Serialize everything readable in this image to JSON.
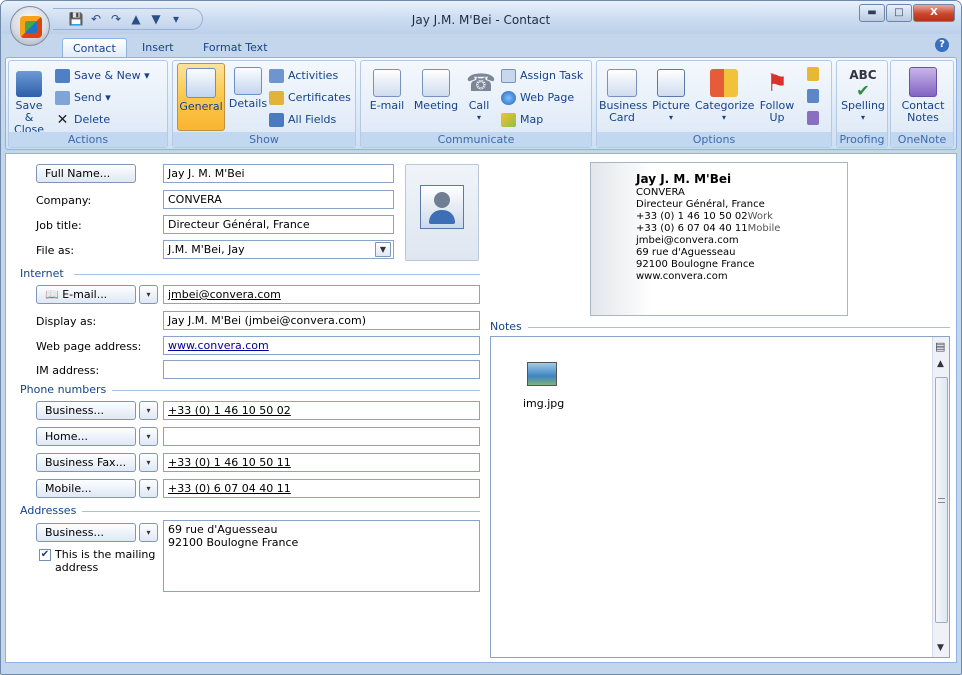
{
  "window": {
    "title": "Jay J.M. M'Bei - Contact",
    "close": "X"
  },
  "tabs": [
    "Contact",
    "Insert",
    "Format Text"
  ],
  "ribbon": {
    "actions": {
      "label": "Actions",
      "save_close_1": "Save &",
      "save_close_2": "Close",
      "save_new": "Save & New",
      "send": "Send",
      "delete": "Delete"
    },
    "show": {
      "label": "Show",
      "general": "General",
      "details": "Details",
      "activities": "Activities",
      "certificates": "Certificates",
      "all_fields": "All Fields"
    },
    "communicate": {
      "label": "Communicate",
      "email": "E-mail",
      "meeting": "Meeting",
      "call": "Call",
      "assign_task": "Assign Task",
      "web_page": "Web Page",
      "map": "Map"
    },
    "options": {
      "label": "Options",
      "business_card_1": "Business",
      "business_card_2": "Card",
      "picture": "Picture",
      "categorize": "Categorize",
      "follow_up_1": "Follow",
      "follow_up_2": "Up"
    },
    "proofing": {
      "label": "Proofing",
      "spelling": "Spelling"
    },
    "onenote": {
      "label": "OneNote",
      "contact_notes_1": "Contact",
      "contact_notes_2": "Notes"
    }
  },
  "form": {
    "full_name_button": "Full Name...",
    "full_name": "Jay J. M. M'Bei",
    "company_label": "Company:",
    "company": "CONVERA",
    "job_title_label": "Job title:",
    "job_title": "Directeur Général, France",
    "file_as_label": "File as:",
    "file_as": "J.M. M'Bei, Jay",
    "internet_section": "Internet",
    "email_button": "E-mail...",
    "email": "jmbei@convera.com",
    "display_as_label": "Display as:",
    "display_as": "Jay J.M. M'Bei (jmbei@convera.com)",
    "web_page_label": "Web page address:",
    "web_page": "www.convera.com",
    "im_label": "IM address:",
    "im": "",
    "phone_section": "Phone numbers",
    "phones": [
      {
        "label": "Business...",
        "value": "+33 (0) 1 46 10 50 02"
      },
      {
        "label": "Home...",
        "value": ""
      },
      {
        "label": "Business Fax...",
        "value": "+33 (0) 1 46 10 50 11"
      },
      {
        "label": "Mobile...",
        "value": "+33 (0) 6 07 04 40 11"
      }
    ],
    "addresses_section": "Addresses",
    "address_button": "Business...",
    "address_line1": "69 rue d'Aguesseau",
    "address_line2": "92100  Boulogne France",
    "mailing_check_1": "This is the mailing",
    "mailing_check_2": "address"
  },
  "card": {
    "name": "Jay J. M. M'Bei",
    "company": "CONVERA",
    "title": "Directeur Général, France",
    "phone_work": "+33 (0) 1 46 10 50 02",
    "phone_work_tag": "Work",
    "phone_mobile": "+33 (0) 6 07 04 40 11",
    "phone_mobile_tag": "Mobile",
    "email": "jmbei@convera.com",
    "street": "69 rue d'Aguesseau",
    "city": "92100  Boulogne France",
    "web": "www.convera.com"
  },
  "notes": {
    "label": "Notes",
    "attachment": "img.jpg"
  }
}
